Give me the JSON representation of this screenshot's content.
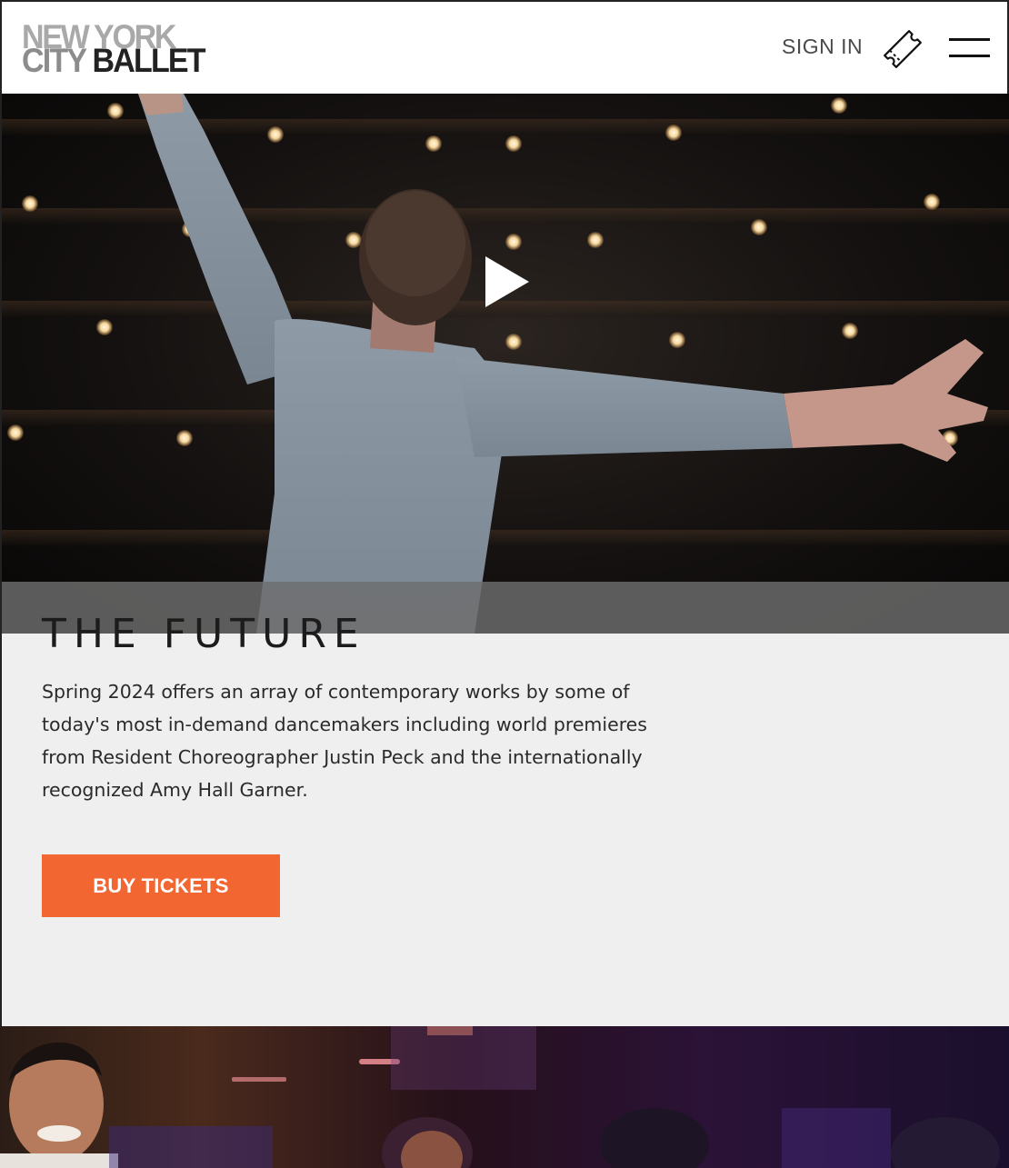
{
  "header": {
    "logo": {
      "line1": "NEW YORK",
      "line2_city": "CITY",
      "line2_ballet": "BALLET"
    },
    "signin_label": "SIGN IN",
    "ticket_icon": "ticket-icon",
    "menu_icon": "hamburger-menu-icon"
  },
  "hero": {
    "media_type": "video",
    "play_icon": "play-icon"
  },
  "content": {
    "title": "THE FUTURE",
    "description": "Spring 2024 offers an array of contemporary works by some of today's most in-demand dancemakers including world premieres from Resident Choreographer Justin Peck and the internationally recognized Amy Hall Garner.",
    "buy_button_label": "BUY TICKETS"
  },
  "colors": {
    "accent": "#f26631",
    "panel_background": "#efefef",
    "text_dark": "#222222",
    "logo_gray": "#a9a9a9"
  }
}
